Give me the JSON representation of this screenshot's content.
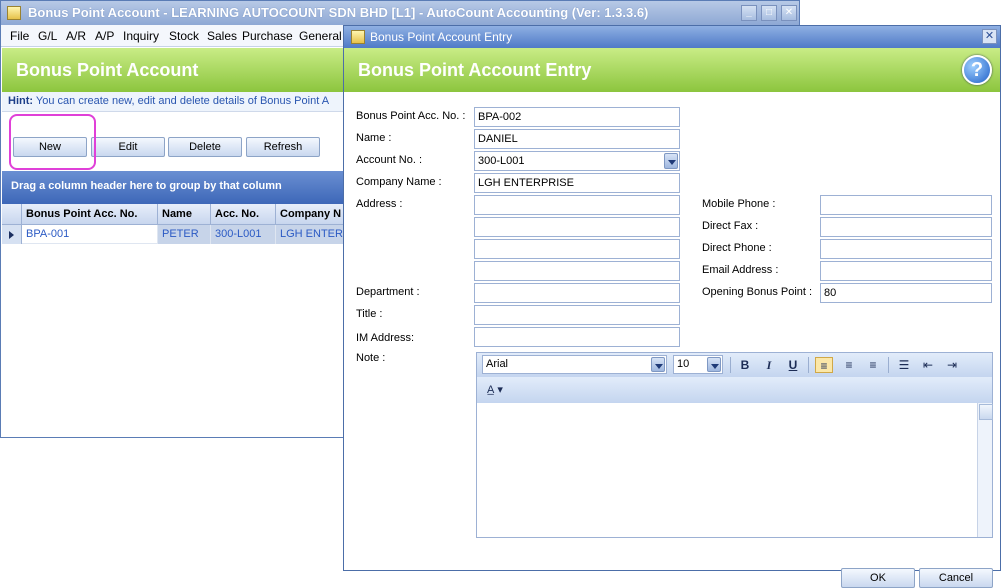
{
  "main_window": {
    "title": "Bonus Point Account - LEARNING AUTOCOUNT SDN BHD [L1] - AutoCount Accounting (Ver: 1.3.3.6)",
    "menu": [
      "File",
      "G/L",
      "A/R",
      "A/P",
      "Inquiry",
      "Stock",
      "Sales",
      "Purchase",
      "General"
    ],
    "banner_title": "Bonus Point Account",
    "hint_label": "Hint:",
    "hint_text": "You can create new, edit and delete details of Bonus Point A",
    "toolbar": {
      "new": "New",
      "edit": "Edit",
      "delete": "Delete",
      "refresh": "Refresh"
    },
    "group_prompt": "Drag a column header here to group by that column",
    "grid": {
      "columns": [
        "Bonus Point Acc. No.",
        "Name",
        "Acc. No.",
        "Company N"
      ],
      "rows": [
        {
          "acc_no": "BPA-001",
          "name": "PETER",
          "account": "300-L001",
          "company": "LGH ENTERPRISE"
        }
      ]
    }
  },
  "dialog": {
    "title": "Bonus Point Account Entry",
    "banner_title": "Bonus Point Account Entry",
    "labels": {
      "bonus_acc_no": "Bonus Point Acc. No. :",
      "name": "Name :",
      "account_no": "Account No. :",
      "company_name": "Company Name :",
      "address": "Address :",
      "department": "Department :",
      "title": "Title :",
      "im_address": "IM Address:",
      "note": "Note :",
      "mobile_phone": "Mobile Phone :",
      "direct_fax": "Direct Fax :",
      "direct_phone": "Direct Phone :",
      "email_address": "Email Address :",
      "opening_bonus_point": "Opening Bonus Point :"
    },
    "values": {
      "bonus_acc_no": "BPA-002",
      "name": "DANIEL",
      "account_no": "300-L001",
      "company_name": "LGH ENTERPRISE",
      "address_lines": [
        "",
        "",
        "",
        ""
      ],
      "department": "",
      "title": "",
      "im_address": "",
      "mobile_phone": "",
      "direct_fax": "",
      "direct_phone": "",
      "email_address": "",
      "opening_bonus_point": "80"
    },
    "editor": {
      "font": "Arial",
      "size": "10",
      "buttons": {
        "bold": "B",
        "italic": "I",
        "underline": "U"
      }
    },
    "ok": "OK",
    "cancel": "Cancel"
  }
}
